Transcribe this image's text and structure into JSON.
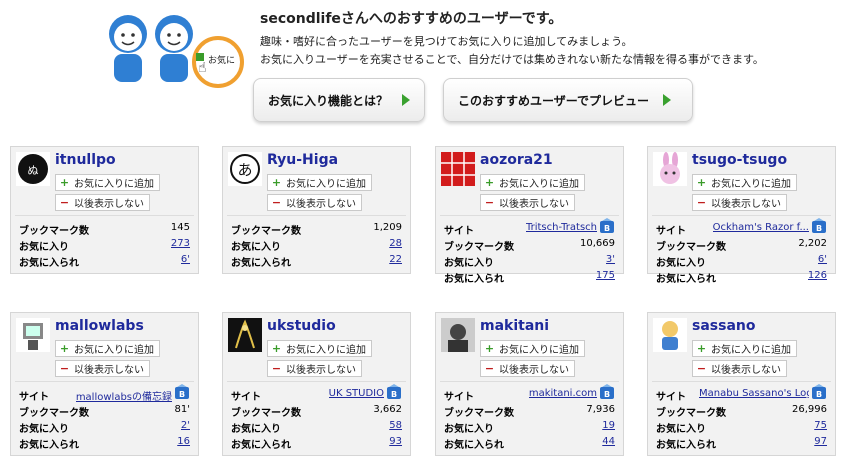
{
  "header": {
    "title": "secondlifeさんへのおすすめのユーザーです。",
    "line1": "趣味・嗜好に合ったユーザーを見つけてお気に入りに追加してみましょう。",
    "line2": "お気に入りユーザーを充実させることで、自分だけでは集めきれない新たな情報を得る事ができます。",
    "mascot_badge": "お気に"
  },
  "buttons": {
    "about": "お気に入り機能とは？",
    "preview": "このおすすめユーザーでプレビュー"
  },
  "labels": {
    "add": "お気に入りに追加",
    "hide": "以後表示しない",
    "site": "サイト",
    "bookmarks": "ブックマーク数",
    "favorites": "お気に入り",
    "favorited": "お気に入られ"
  },
  "users": [
    {
      "name": "itnullpo",
      "site": null,
      "bookmarks": "145",
      "favorites": "273",
      "favorited": "6'"
    },
    {
      "name": "Ryu-Higa",
      "site": null,
      "bookmarks": "1,209",
      "favorites": "28",
      "favorited": "22"
    },
    {
      "name": "aozora21",
      "site": "Tritsch-Tratsch",
      "bookmarks": "10,669",
      "favorites": "3'",
      "favorited": "175"
    },
    {
      "name": "tsugo-tsugo",
      "site": "Ockham's Razor f...",
      "bookmarks": "2,202",
      "favorites": "6'",
      "favorited": "126"
    },
    {
      "name": "mallowlabs",
      "site": "mallowlabsの備忘録",
      "bookmarks": "81'",
      "favorites": "2'",
      "favorited": "16"
    },
    {
      "name": "ukstudio",
      "site": "UK STUDIO",
      "bookmarks": "3,662",
      "favorites": "58",
      "favorited": "93"
    },
    {
      "name": "makitani",
      "site": "makitani.com",
      "bookmarks": "7,936",
      "favorites": "19",
      "favorited": "44"
    },
    {
      "name": "sassano",
      "site": "Manabu Sassano's Log",
      "bookmarks": "26,996",
      "favorites": "75",
      "favorited": "97"
    }
  ],
  "colors": {
    "link": "#1f2a9c",
    "add_green": "#3a9c2a",
    "remove_red": "#c01e1e",
    "card_bg": "#f2f2f2"
  }
}
